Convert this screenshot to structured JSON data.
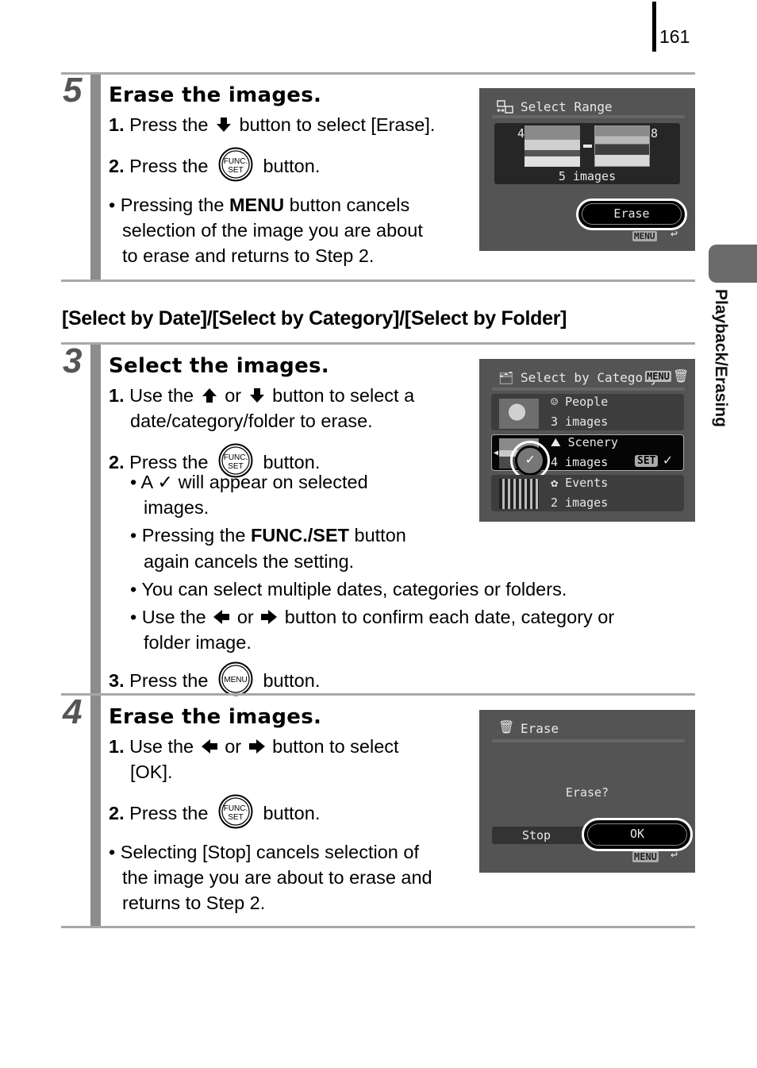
{
  "page": {
    "number": "161",
    "side_tab": "Playback/Erasing",
    "section_heading": "[Select by Date]/[Select by Category]/[Select by Folder]"
  },
  "step5": {
    "number": "5",
    "title": "Erase the images.",
    "s1_num": "1.",
    "s1_a": "Press the",
    "s1_b": "button to select [Erase].",
    "s2_num": "2.",
    "s2_a": "Press the",
    "s2_b": "button.",
    "note_a": "Pressing the",
    "note_bold": "MENU",
    "note_b": "button cancels",
    "note_l2": "selection of the image you are about",
    "note_l3": "to erase and returns to Step 2.",
    "bullet": "•"
  },
  "step3": {
    "number": "3",
    "title": "Select the images.",
    "s1_num": "1.",
    "s1_a": "Use the",
    "s1_or": "or",
    "s1_b": "button to select a",
    "s1_l2": "date/category/folder to erase.",
    "s2_num": "2.",
    "s2_a": "Press the",
    "s2_b": "button.",
    "b1_l1": "A ✓ will appear on selected",
    "b1_l2": "images.",
    "b2_a": "Pressing the",
    "b2_bold": "FUNC./SET",
    "b2_b": "button",
    "b2_l2": "again cancels the setting.",
    "b3": "You can select multiple dates, categories or folders.",
    "b4_a": "Use the",
    "b4_or": "or",
    "b4_b": "button to confirm each date, category or",
    "b4_l2": "folder image.",
    "s3_num": "3.",
    "s3_a": "Press the",
    "s3_b": "button.",
    "bullet": "•"
  },
  "step4": {
    "number": "4",
    "title": "Erase the images.",
    "s1_num": "1.",
    "s1_a": "Use the",
    "s1_or": "or",
    "s1_b": "button to select",
    "s1_l2": "[OK].",
    "s2_num": "2.",
    "s2_a": "Press the",
    "s2_b": "button.",
    "note_l1": "Selecting [Stop] cancels selection of",
    "note_l2": "the image you are about to erase and",
    "note_l3": "returns to Step 2.",
    "bullet": "•"
  },
  "buttons": {
    "func_top": "FUNC.",
    "func_bottom": "SET",
    "menu": "MENU"
  },
  "screen_range": {
    "title": "Select Range",
    "start": "4",
    "end": "8",
    "count": "5 images",
    "button": "Erase",
    "menu": "MENU"
  },
  "screen_category": {
    "title": "Select by Category",
    "menu": "MENU",
    "items": [
      {
        "name": "People",
        "count": "3 images"
      },
      {
        "name": "Scenery",
        "count": "4 images",
        "badge": "SET",
        "check": "✓"
      },
      {
        "name": "Events",
        "count": "2 images"
      }
    ],
    "thumb_check": "✓"
  },
  "screen_erase": {
    "title": "Erase",
    "prompt": "Erase?",
    "stop": "Stop",
    "ok": "OK",
    "menu": "MENU"
  }
}
